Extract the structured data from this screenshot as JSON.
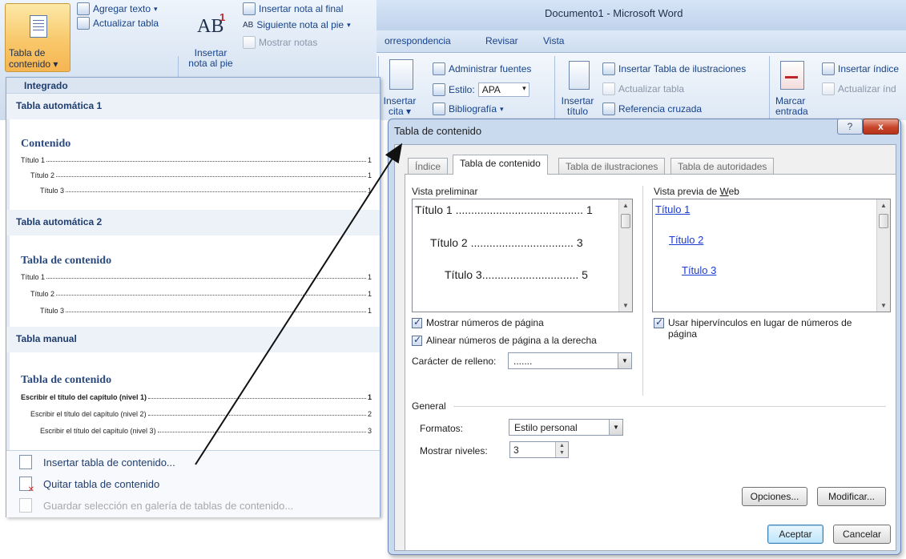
{
  "ribbon": {
    "window_title": "Documento1 - Microsoft Word",
    "tabs": [
      "orrespondencia",
      "Revisar",
      "Vista"
    ],
    "toc_button": {
      "line1": "Tabla de",
      "line2": "contenido"
    },
    "add_text": "Agregar texto",
    "update_table": "Actualizar tabla",
    "insert_footnote": {
      "line1": "Insertar",
      "line2": "nota al pie"
    },
    "insert_endnote": "Insertar nota al final",
    "next_footnote": "Siguiente nota al pie",
    "show_notes": "Mostrar notas",
    "manage_sources": "Administrar fuentes",
    "style_label": "Estilo:",
    "style_value": "APA",
    "bibliography": "Bibliografía",
    "insert_citation": {
      "line1": "Insertar",
      "line2": "cita"
    },
    "insert_caption": {
      "line1": "Insertar",
      "line2": "título"
    },
    "insert_figures_table": "Insertar Tabla de ilustraciones",
    "update_table2": "Actualizar tabla",
    "cross_reference": "Referencia cruzada",
    "mark_entry": {
      "line1": "Marcar",
      "line2": "entrada"
    },
    "insert_index": "Insertar índice",
    "update_index": "Actualizar índ"
  },
  "dropdown": {
    "header": "Integrado",
    "auto1": {
      "title": "Tabla automática 1",
      "heading": "Contenido",
      "lines": [
        {
          "text": "Título 1",
          "page": "1"
        },
        {
          "text": "Título 2",
          "page": "1"
        },
        {
          "text": "Título 3",
          "page": "1"
        }
      ]
    },
    "auto2": {
      "title": "Tabla automática 2",
      "heading": "Tabla de contenido",
      "lines": [
        {
          "text": "Título 1",
          "page": "1"
        },
        {
          "text": "Título 2",
          "page": "1"
        },
        {
          "text": "Título 3",
          "page": "1"
        }
      ]
    },
    "manual": {
      "title": "Tabla manual",
      "heading": "Tabla de contenido",
      "lines": [
        {
          "text": "Escribir el título del capítulo (nivel 1)",
          "page": "1"
        },
        {
          "text": "Escribir el título del capítulo (nivel 2)",
          "page": "2"
        },
        {
          "text": "Escribir el título del capítulo (nivel 3)",
          "page": "3"
        }
      ]
    },
    "commands": {
      "insert": "Insertar tabla de contenido...",
      "remove": "Quitar tabla de contenido",
      "save": "Guardar selección en galería de tablas de contenido..."
    }
  },
  "dialog": {
    "title": "Tabla de contenido",
    "help": "?",
    "close": "x",
    "tabs": [
      "Índice",
      "Tabla de contenido",
      "Tabla de ilustraciones",
      "Tabla de autoridades"
    ],
    "print_preview_label": "Vista preliminar",
    "print_preview": [
      {
        "text": "Título 1 ......................................... 1"
      },
      {
        "text": "Título 2 ................................. 3"
      },
      {
        "text": "Título 3............................... 5"
      }
    ],
    "web_preview_label": "Vista previa de Web",
    "web_preview": [
      "Título 1",
      "Título 2",
      "Título 3"
    ],
    "show_page_numbers": "Mostrar números de página",
    "right_align": "Alinear números de página a la derecha",
    "tab_leader_label": "Carácter de relleno:",
    "tab_leader_value": ".......",
    "use_hyperlinks": "Usar hipervínculos en lugar de números de",
    "use_hyperlinks_2": "página",
    "general_label": "General",
    "formats_label": "Formatos:",
    "formats_value": "Estilo personal",
    "show_levels_label": "Mostrar niveles:",
    "show_levels_value": "3",
    "options_button": "Opciones...",
    "modify_button": "Modificar...",
    "ok_button": "Aceptar",
    "cancel_button": "Cancelar"
  }
}
